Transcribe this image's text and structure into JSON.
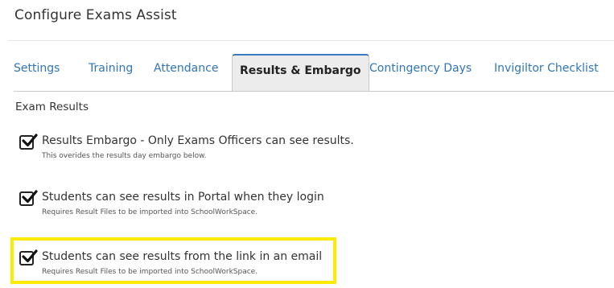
{
  "page": {
    "title": "Configure Exams Assist"
  },
  "tabs": [
    {
      "label": "Settings"
    },
    {
      "label": "Training"
    },
    {
      "label": "Attendance"
    },
    {
      "label": "Results & Embargo",
      "active": true
    },
    {
      "label": "Contingency Days"
    },
    {
      "label": "Invigiltor Checklist"
    }
  ],
  "section": {
    "title": "Exam Results"
  },
  "options": [
    {
      "label": "Results Embargo - Only Exams Officers can see results.",
      "description": "This overides the results day embargo below.",
      "checked": true
    },
    {
      "label": "Students can see results in Portal when they login",
      "description": "Requires Result Files to be imported into SchoolWorkSpace.",
      "checked": true
    },
    {
      "label": "Students can see results from the link in an email",
      "description": "Requires Result Files to be imported into SchoolWorkSpace.",
      "checked": true
    }
  ],
  "colors": {
    "tab_link": "#2f76b8",
    "highlight": "#ffeb00",
    "active_tab_bg": "#ececec"
  },
  "icons": {
    "checkbox": "checkmark-icon"
  }
}
